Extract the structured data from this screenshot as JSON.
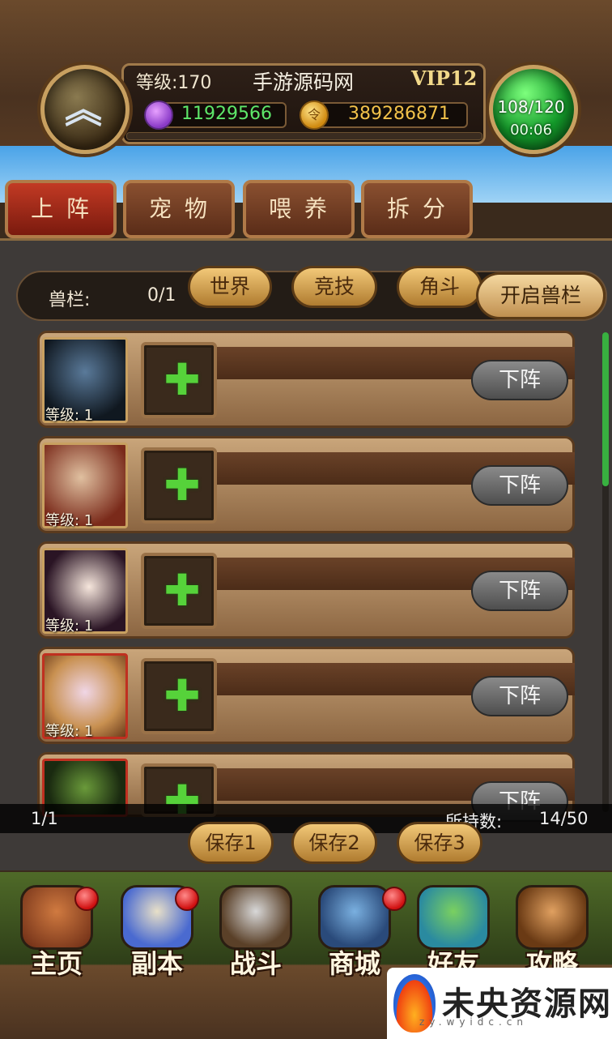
{
  "header": {
    "level_text": "等级:170",
    "player_name": "手游源码网",
    "vip": "VIP12",
    "gems": "11929566",
    "coins": "389286871",
    "stamina": "108/120",
    "stamina_timer": "00:06",
    "coin_glyph": "令"
  },
  "tabs": [
    "上阵",
    "宠物",
    "喂养",
    "拆分"
  ],
  "filter": {
    "slot_label": "兽栏:",
    "slot_count": "0/1",
    "buttons": [
      "世界",
      "竞技",
      "角斗"
    ],
    "open_button": "开启兽栏"
  },
  "rows": [
    {
      "level": "等级:  1",
      "remove_label": "下阵",
      "add_symbol": "✚"
    },
    {
      "level": "等级:  1",
      "remove_label": "下阵",
      "add_symbol": "✚"
    },
    {
      "level": "等级:  1",
      "remove_label": "下阵",
      "add_symbol": "✚"
    },
    {
      "level": "等级:  1",
      "remove_label": "下阵",
      "add_symbol": "✚"
    },
    {
      "level": "",
      "remove_label": "下阵",
      "add_symbol": "✚"
    }
  ],
  "footer": {
    "page": "1/1",
    "held_label": "所持数:",
    "held_value": "14/50",
    "save_buttons": [
      "保存1",
      "保存2",
      "保存3"
    ]
  },
  "nav": [
    {
      "label": "主页",
      "icon": "house-icon",
      "badge": true
    },
    {
      "label": "副本",
      "icon": "skull-icon",
      "badge": true
    },
    {
      "label": "战斗",
      "icon": "axe-sword-icon",
      "badge": false
    },
    {
      "label": "商城",
      "icon": "monster-shop-icon",
      "badge": true
    },
    {
      "label": "好友",
      "icon": "friends-icon",
      "badge": false
    },
    {
      "label": "攻略",
      "icon": "book-icon",
      "badge": false
    }
  ],
  "watermark": {
    "text": "未央资源网",
    "url": "zy.wyidc.cn"
  },
  "colors": {
    "gem": "#5ee86a",
    "coin": "#f2c24a",
    "vip": "#f2d98a",
    "add": "#56d23a",
    "active_tab": "#c23a24"
  }
}
